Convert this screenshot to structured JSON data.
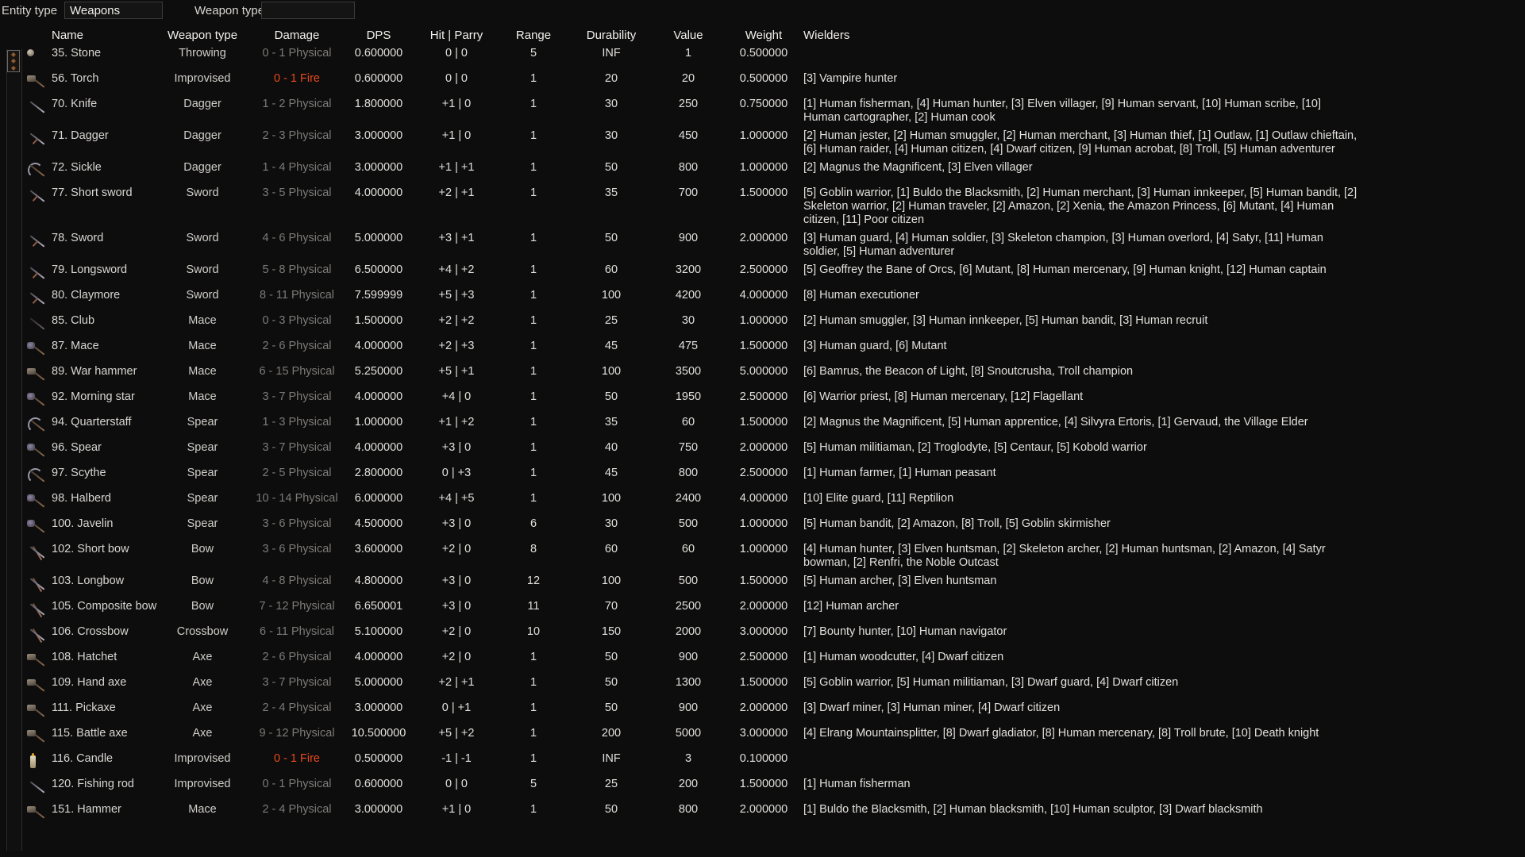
{
  "filters": {
    "entity_type_label": "Entity type",
    "entity_type_value": "Weapons",
    "entity_type_placeholder": "",
    "weapon_type_label": "Weapon type",
    "weapon_type_value": "",
    "weapon_type_placeholder": ""
  },
  "colors": {
    "background": "#0d0d0d",
    "text": "#e2e0dc",
    "damage_physical": "#7d7b78",
    "damage_fire": "#e8491c",
    "scroll_accent": "#8a5a32"
  },
  "table": {
    "headers": {
      "name": "Name",
      "weapon_type": "Weapon type",
      "damage": "Damage",
      "dps": "DPS",
      "hit_parry": "Hit | Parry",
      "range": "Range",
      "durability": "Durability",
      "value": "Value",
      "weight": "Weight",
      "wielders": "Wielders"
    },
    "rows": [
      {
        "icon": "stone-icon",
        "name": "35. Stone",
        "weapon_type": "Throwing",
        "damage": "0 - 1 Physical",
        "damage_kind": "physical",
        "dps": "0.600000",
        "hit_parry": "0 | 0",
        "range": "5",
        "durability": "INF",
        "value": "1",
        "weight": "0.500000",
        "wielders": ""
      },
      {
        "icon": "torch-icon",
        "name": "56. Torch",
        "weapon_type": "Improvised",
        "damage": "0 - 1 Fire",
        "damage_kind": "fire",
        "dps": "0.600000",
        "hit_parry": "0 | 0",
        "range": "1",
        "durability": "20",
        "value": "20",
        "weight": "0.500000",
        "wielders": "[3] Vampire hunter"
      },
      {
        "icon": "knife-icon",
        "name": "70. Knife",
        "weapon_type": "Dagger",
        "damage": "1 - 2 Physical",
        "damage_kind": "physical",
        "dps": "1.800000",
        "hit_parry": "+1 | 0",
        "range": "1",
        "durability": "30",
        "value": "250",
        "weight": "0.750000",
        "wielders": "[1] Human fisherman, [4] Human hunter, [3] Elven villager, [9] Human servant, [10] Human scribe, [10] Human cartographer, [2] Human cook"
      },
      {
        "icon": "dagger-icon",
        "name": "71. Dagger",
        "weapon_type": "Dagger",
        "damage": "2 - 3 Physical",
        "damage_kind": "physical",
        "dps": "3.000000",
        "hit_parry": "+1 | 0",
        "range": "1",
        "durability": "30",
        "value": "450",
        "weight": "1.000000",
        "wielders": "[2] Human jester, [2] Human smuggler, [2] Human merchant, [3] Human thief, [1] Outlaw, [1] Outlaw chieftain, [6] Human raider, [4] Human citizen, [4] Dwarf citizen, [9] Human acrobat, [8] Troll, [5] Human adventurer"
      },
      {
        "icon": "sickle-icon",
        "name": "72. Sickle",
        "weapon_type": "Dagger",
        "damage": "1 - 4 Physical",
        "damage_kind": "physical",
        "dps": "3.000000",
        "hit_parry": "+1 | +1",
        "range": "1",
        "durability": "50",
        "value": "800",
        "weight": "1.000000",
        "wielders": "[2] Magnus the Magnificent, [3] Elven villager"
      },
      {
        "icon": "short-sword-icon",
        "name": "77. Short sword",
        "weapon_type": "Sword",
        "damage": "3 - 5 Physical",
        "damage_kind": "physical",
        "dps": "4.000000",
        "hit_parry": "+2 | +1",
        "range": "1",
        "durability": "35",
        "value": "700",
        "weight": "1.500000",
        "wielders": "[5] Goblin warrior, [1] Buldo the Blacksmith, [2] Human merchant, [3] Human innkeeper, [5] Human bandit, [2] Skeleton warrior, [2] Human traveler, [2] Amazon, [2] Xenia, the Amazon Princess, [6] Mutant, [4] Human citizen, [11] Poor citizen"
      },
      {
        "icon": "sword-icon",
        "name": "78. Sword",
        "weapon_type": "Sword",
        "damage": "4 - 6 Physical",
        "damage_kind": "physical",
        "dps": "5.000000",
        "hit_parry": "+3 | +1",
        "range": "1",
        "durability": "50",
        "value": "900",
        "weight": "2.000000",
        "wielders": "[3] Human guard, [4] Human soldier, [3] Skeleton champion, [3] Human overlord, [4] Satyr, [11] Human soldier, [5] Human adventurer"
      },
      {
        "icon": "longsword-icon",
        "name": "79. Longsword",
        "weapon_type": "Sword",
        "damage": "5 - 8 Physical",
        "damage_kind": "physical",
        "dps": "6.500000",
        "hit_parry": "+4 | +2",
        "range": "1",
        "durability": "60",
        "value": "3200",
        "weight": "2.500000",
        "wielders": "[5] Geoffrey the Bane of Orcs, [6] Mutant, [8] Human mercenary, [9] Human knight, [12] Human captain"
      },
      {
        "icon": "claymore-icon",
        "name": "80. Claymore",
        "weapon_type": "Sword",
        "damage": "8 - 11 Physical",
        "damage_kind": "physical",
        "dps": "7.599999",
        "hit_parry": "+5 | +3",
        "range": "1",
        "durability": "100",
        "value": "4200",
        "weight": "4.000000",
        "wielders": "[8] Human executioner"
      },
      {
        "icon": "club-icon",
        "name": "85. Club",
        "weapon_type": "Mace",
        "damage": "0 - 3 Physical",
        "damage_kind": "physical",
        "dps": "1.500000",
        "hit_parry": "+2 | +2",
        "range": "1",
        "durability": "25",
        "value": "30",
        "weight": "1.000000",
        "wielders": "[2] Human smuggler, [3] Human innkeeper, [5] Human bandit, [3] Human recruit"
      },
      {
        "icon": "mace-icon",
        "name": "87. Mace",
        "weapon_type": "Mace",
        "damage": "2 - 6 Physical",
        "damage_kind": "physical",
        "dps": "4.000000",
        "hit_parry": "+2 | +3",
        "range": "1",
        "durability": "45",
        "value": "475",
        "weight": "1.500000",
        "wielders": "[3] Human guard, [6] Mutant"
      },
      {
        "icon": "war-hammer-icon",
        "name": "89. War hammer",
        "weapon_type": "Mace",
        "damage": "6 - 15 Physical",
        "damage_kind": "physical",
        "dps": "5.250000",
        "hit_parry": "+5 | +1",
        "range": "1",
        "durability": "100",
        "value": "3500",
        "weight": "5.000000",
        "wielders": "[6] Bamrus, the Beacon of Light, [8] Snoutcrusha, Troll champion"
      },
      {
        "icon": "morning-star-icon",
        "name": "92. Morning star",
        "weapon_type": "Mace",
        "damage": "3 - 7 Physical",
        "damage_kind": "physical",
        "dps": "4.000000",
        "hit_parry": "+4 | 0",
        "range": "1",
        "durability": "50",
        "value": "1950",
        "weight": "2.500000",
        "wielders": "[6] Warrior priest, [8] Human mercenary, [12] Flagellant"
      },
      {
        "icon": "quarterstaff-icon",
        "name": "94. Quarterstaff",
        "weapon_type": "Spear",
        "damage": "1 - 3 Physical",
        "damage_kind": "physical",
        "dps": "1.000000",
        "hit_parry": "+1 | +2",
        "range": "1",
        "durability": "35",
        "value": "60",
        "weight": "1.500000",
        "wielders": "[2] Magnus the Magnificent, [5] Human apprentice, [4] Silvyra Ertoris, [1] Gervaud, the Village Elder"
      },
      {
        "icon": "spear-icon",
        "name": "96. Spear",
        "weapon_type": "Spear",
        "damage": "3 - 7 Physical",
        "damage_kind": "physical",
        "dps": "4.000000",
        "hit_parry": "+3 | 0",
        "range": "1",
        "durability": "40",
        "value": "750",
        "weight": "2.000000",
        "wielders": "[5] Human militiaman, [2] Troglodyte, [5] Centaur, [5] Kobold warrior"
      },
      {
        "icon": "scythe-icon",
        "name": "97. Scythe",
        "weapon_type": "Spear",
        "damage": "2 - 5 Physical",
        "damage_kind": "physical",
        "dps": "2.800000",
        "hit_parry": "0 | +3",
        "range": "1",
        "durability": "45",
        "value": "800",
        "weight": "2.500000",
        "wielders": "[1] Human farmer, [1] Human peasant"
      },
      {
        "icon": "halberd-icon",
        "name": "98. Halberd",
        "weapon_type": "Spear",
        "damage": "10 - 14 Physical",
        "damage_kind": "physical",
        "dps": "6.000000",
        "hit_parry": "+4 | +5",
        "range": "1",
        "durability": "100",
        "value": "2400",
        "weight": "4.000000",
        "wielders": "[10] Elite guard, [11] Reptilion"
      },
      {
        "icon": "javelin-icon",
        "name": "100. Javelin",
        "weapon_type": "Spear",
        "damage": "3 - 6 Physical",
        "damage_kind": "physical",
        "dps": "4.500000",
        "hit_parry": "+3 | 0",
        "range": "6",
        "durability": "30",
        "value": "500",
        "weight": "1.000000",
        "wielders": "[5] Human bandit, [2] Amazon, [8] Troll, [5] Goblin skirmisher"
      },
      {
        "icon": "short-bow-icon",
        "name": "102. Short bow",
        "weapon_type": "Bow",
        "damage": "3 - 6 Physical",
        "damage_kind": "physical",
        "dps": "3.600000",
        "hit_parry": "+2 | 0",
        "range": "8",
        "durability": "60",
        "value": "60",
        "weight": "1.000000",
        "wielders": "[4] Human hunter, [3] Elven huntsman, [2] Skeleton archer, [2] Human huntsman, [2] Amazon, [4] Satyr bowman, [2] Renfri, the Noble Outcast"
      },
      {
        "icon": "longbow-icon",
        "name": "103. Longbow",
        "weapon_type": "Bow",
        "damage": "4 - 8 Physical",
        "damage_kind": "physical",
        "dps": "4.800000",
        "hit_parry": "+3 | 0",
        "range": "12",
        "durability": "100",
        "value": "500",
        "weight": "1.500000",
        "wielders": "[5] Human archer, [3] Elven huntsman"
      },
      {
        "icon": "composite-bow-icon",
        "name": "105. Composite bow",
        "weapon_type": "Bow",
        "damage": "7 - 12 Physical",
        "damage_kind": "physical",
        "dps": "6.650001",
        "hit_parry": "+3 | 0",
        "range": "11",
        "durability": "70",
        "value": "2500",
        "weight": "2.000000",
        "wielders": "[12] Human archer"
      },
      {
        "icon": "crossbow-icon",
        "name": "106. Crossbow",
        "weapon_type": "Crossbow",
        "damage": "6 - 11 Physical",
        "damage_kind": "physical",
        "dps": "5.100000",
        "hit_parry": "+2 | 0",
        "range": "10",
        "durability": "150",
        "value": "2000",
        "weight": "3.000000",
        "wielders": "[7] Bounty hunter, [10] Human navigator"
      },
      {
        "icon": "hatchet-icon",
        "name": "108. Hatchet",
        "weapon_type": "Axe",
        "damage": "2 - 6 Physical",
        "damage_kind": "physical",
        "dps": "4.000000",
        "hit_parry": "+2 | 0",
        "range": "1",
        "durability": "50",
        "value": "900",
        "weight": "2.500000",
        "wielders": "[1] Human woodcutter, [4] Dwarf citizen"
      },
      {
        "icon": "hand-axe-icon",
        "name": "109. Hand axe",
        "weapon_type": "Axe",
        "damage": "3 - 7 Physical",
        "damage_kind": "physical",
        "dps": "5.000000",
        "hit_parry": "+2 | +1",
        "range": "1",
        "durability": "50",
        "value": "1300",
        "weight": "1.500000",
        "wielders": "[5] Goblin warrior, [5] Human militiaman, [3] Dwarf guard, [4] Dwarf citizen"
      },
      {
        "icon": "pickaxe-icon",
        "name": "111. Pickaxe",
        "weapon_type": "Axe",
        "damage": "2 - 4 Physical",
        "damage_kind": "physical",
        "dps": "3.000000",
        "hit_parry": "0 | +1",
        "range": "1",
        "durability": "50",
        "value": "900",
        "weight": "2.000000",
        "wielders": "[3] Dwarf miner, [3] Human miner, [4] Dwarf citizen"
      },
      {
        "icon": "battle-axe-icon",
        "name": "115. Battle axe",
        "weapon_type": "Axe",
        "damage": "9 - 12 Physical",
        "damage_kind": "physical",
        "dps": "10.500000",
        "hit_parry": "+5 | +2",
        "range": "1",
        "durability": "200",
        "value": "5000",
        "weight": "3.000000",
        "wielders": "[4] Elrang Mountainsplitter, [8] Dwarf gladiator, [8] Human mercenary, [8] Troll brute, [10] Death knight"
      },
      {
        "icon": "candle-icon",
        "name": "116. Candle",
        "weapon_type": "Improvised",
        "damage": "0 - 1 Fire",
        "damage_kind": "fire",
        "dps": "0.500000",
        "hit_parry": "-1 | -1",
        "range": "1",
        "durability": "INF",
        "value": "3",
        "weight": "0.100000",
        "wielders": ""
      },
      {
        "icon": "fishing-rod-icon",
        "name": "120. Fishing rod",
        "weapon_type": "Improvised",
        "damage": "0 - 1 Physical",
        "damage_kind": "physical",
        "dps": "0.600000",
        "hit_parry": "0 | 0",
        "range": "5",
        "durability": "25",
        "value": "200",
        "weight": "1.500000",
        "wielders": "[1] Human fisherman"
      },
      {
        "icon": "hammer-icon",
        "name": "151. Hammer",
        "weapon_type": "Mace",
        "damage": "2 - 4 Physical",
        "damage_kind": "physical",
        "dps": "3.000000",
        "hit_parry": "+1 | 0",
        "range": "1",
        "durability": "50",
        "value": "800",
        "weight": "2.000000",
        "wielders": "[1] Buldo the Blacksmith, [2] Human blacksmith, [10] Human sculptor, [3] Dwarf blacksmith"
      }
    ]
  }
}
